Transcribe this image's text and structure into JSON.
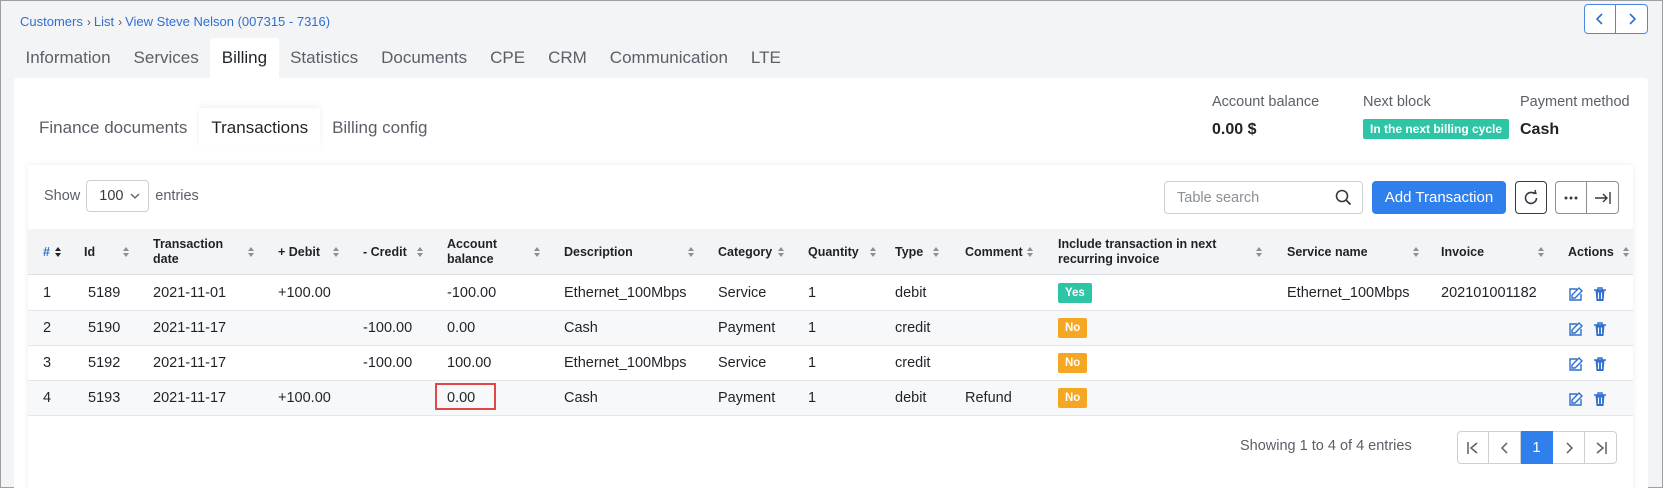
{
  "breadcrumb": {
    "items": [
      "Customers",
      "List",
      "View Steve Nelson (007315 - 7316)"
    ]
  },
  "top_tabs": [
    "Information",
    "Services",
    "Billing",
    "Statistics",
    "Documents",
    "CPE",
    "CRM",
    "Communication",
    "LTE"
  ],
  "top_tabs_active": "Billing",
  "sub_tabs": [
    "Finance documents",
    "Transactions",
    "Billing config"
  ],
  "sub_tabs_active": "Transactions",
  "summary": {
    "balance_label": "Account balance",
    "balance_value": "0.00 $",
    "next_block_label": "Next block",
    "next_block_value": "In the next billing cycle",
    "payment_label": "Payment method",
    "payment_value": "Cash"
  },
  "table_controls": {
    "show_label": "Show",
    "entries_value": "100",
    "entries_label": "entries",
    "search_placeholder": "Table search",
    "add_button": "Add Transaction"
  },
  "columns": [
    "#",
    "Id",
    "Transaction date",
    "+ Debit",
    "- Credit",
    "Account balance",
    "Description",
    "Category",
    "Quantity",
    "Type",
    "Comment",
    "Include transaction in next recurring invoice",
    "Service name",
    "Invoice",
    "Actions"
  ],
  "rows": [
    {
      "num": "1",
      "id": "5189",
      "date": "2021-11-01",
      "debit": "+100.00",
      "credit": "",
      "balance": "-100.00",
      "description": "Ethernet_100Mbps",
      "category": "Service",
      "quantity": "1",
      "type": "debit",
      "comment": "",
      "include": "Yes",
      "service": "Ethernet_100Mbps",
      "invoice": "202101001182"
    },
    {
      "num": "2",
      "id": "5190",
      "date": "2021-11-17",
      "debit": "",
      "credit": "-100.00",
      "balance": "0.00",
      "description": "Cash",
      "category": "Payment",
      "quantity": "1",
      "type": "credit",
      "comment": "",
      "include": "No",
      "service": "",
      "invoice": ""
    },
    {
      "num": "3",
      "id": "5192",
      "date": "2021-11-17",
      "debit": "",
      "credit": "-100.00",
      "balance": "100.00",
      "description": "Ethernet_100Mbps",
      "category": "Service",
      "quantity": "1",
      "type": "credit",
      "comment": "",
      "include": "No",
      "service": "",
      "invoice": ""
    },
    {
      "num": "4",
      "id": "5193",
      "date": "2021-11-17",
      "debit": "+100.00",
      "credit": "",
      "balance": "0.00",
      "description": "Cash",
      "category": "Payment",
      "quantity": "1",
      "type": "debit",
      "comment": "Refund",
      "include": "No",
      "service": "",
      "invoice": ""
    }
  ],
  "footer": {
    "showing": "Showing 1 to 4 of 4 entries",
    "current_page": "1"
  },
  "icons": {
    "edit": "edit-icon",
    "delete": "trash-icon",
    "refresh": "refresh-icon",
    "more": "more-icon",
    "export": "export-icon",
    "search": "search-icon"
  },
  "colors": {
    "accent": "#2f80ed",
    "link": "#2f6fd0",
    "yes": "#2ec4a6",
    "no": "#f5a623",
    "highlight": "#e04848"
  }
}
